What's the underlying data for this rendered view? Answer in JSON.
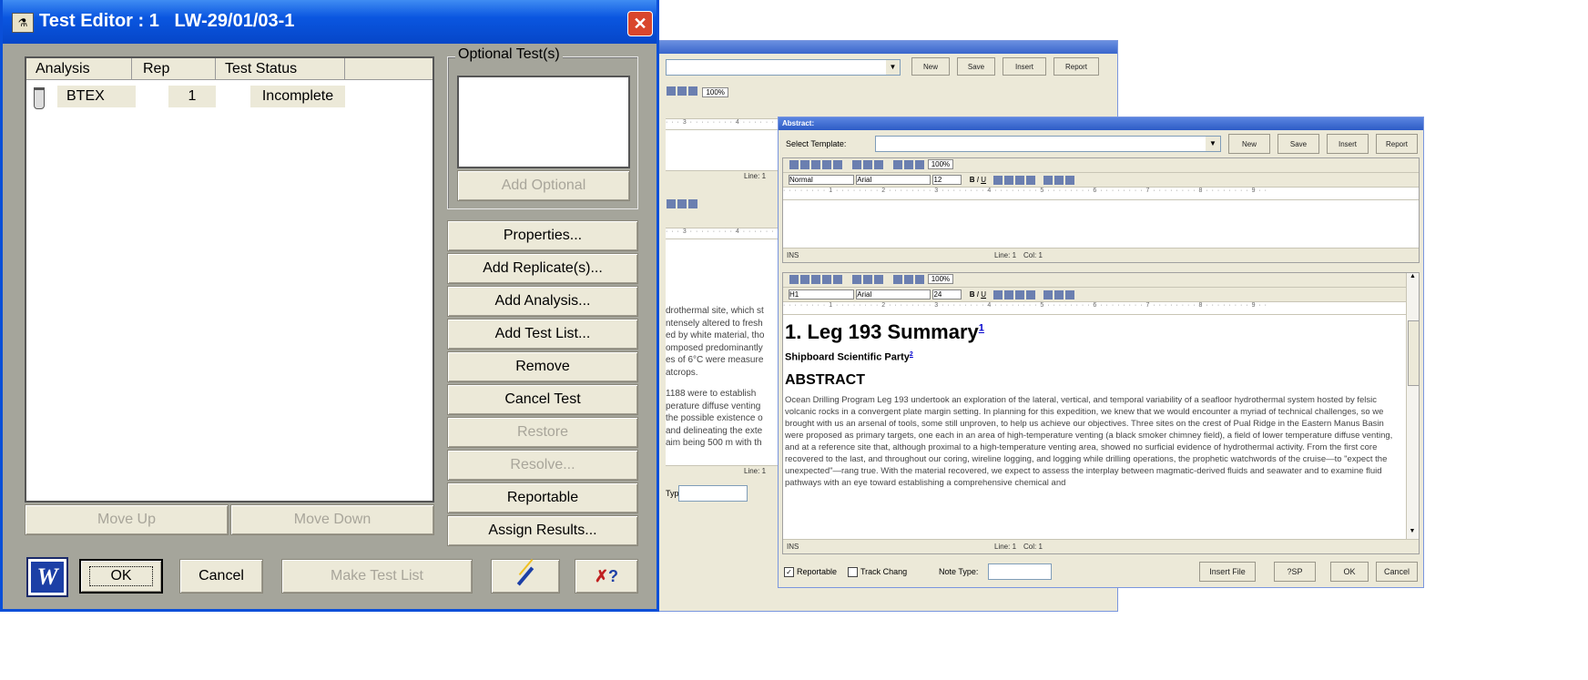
{
  "dialog": {
    "title": "Test Editor : 1   LW-29/01/03-1",
    "table": {
      "headers": [
        "Analysis",
        "Rep",
        "Test Status"
      ],
      "rows": [
        {
          "analysis": "BTEX",
          "rep": "1",
          "status": "Incomplete"
        }
      ]
    },
    "optional_group_label": "Optional Test(s)",
    "add_optional": "Add Optional",
    "side_buttons": [
      "Properties...",
      "Add Replicate(s)...",
      "Add Analysis...",
      "Add Test List...",
      "Remove",
      "Cancel Test",
      "Restore",
      "Resolve...",
      "Reportable",
      "Assign Results..."
    ],
    "move_up": "Move Up",
    "move_down": "Move Down",
    "ok": "OK",
    "cancel": "Cancel",
    "make_test_list": "Make Test List"
  },
  "back_window": {
    "buttons": [
      "New",
      "Save",
      "Insert",
      "Report"
    ],
    "zoom": "100%",
    "line_label": "Line: 1",
    "note_type_label": "Type:",
    "body_lines": [
      "drothermal site, which st",
      "ntensely altered to fresh",
      "ed by white material, tho",
      "omposed predominantly",
      "es of 6°C were measure",
      "atcrops.",
      "",
      "1188 were to establish",
      "perature diffuse venting",
      "the possible existence o",
      "and delineating the exte",
      "aim being 500 m with th"
    ]
  },
  "abstract_window": {
    "title": "Abstract:",
    "select_template_label": "Select Template:",
    "buttons": [
      "New",
      "Save",
      "Insert",
      "Report"
    ],
    "editor1": {
      "style": "Normal",
      "font": "Arial",
      "size": "12",
      "zoom": "100%",
      "status_ins": "INS",
      "status_line": "Line: 1",
      "status_col": "Col: 1"
    },
    "editor2": {
      "style": "H1",
      "font": "Arial",
      "size": "24",
      "zoom": "100%",
      "status_ins": "INS",
      "status_line": "Line: 1",
      "status_col": "Col: 1"
    },
    "doc": {
      "heading": "1. Leg 193 Summary",
      "heading_sup": "1",
      "subheading": "Shipboard Scientific Party",
      "subheading_sup": "2",
      "abstract_heading": "ABSTRACT",
      "paragraph": "Ocean Drilling Program Leg 193 undertook an exploration of the lateral, vertical, and temporal variability of a seafloor hydrothermal system hosted by felsic volcanic rocks in a convergent plate margin setting. In planning for this expedition, we knew that we would encounter a myriad of technical challenges, so we brought with us an arsenal of tools, some still unproven, to help us achieve our objectives. Three sites on the crest of Pual Ridge in the Eastern Manus Basin were proposed as primary targets, one each in an area of high-temperature venting (a black smoker chimney field), a field of lower temperature diffuse venting, and at a reference site that, although proximal to a high-temperature venting area, showed no surficial evidence of hydrothermal activity. From the first core recovered to the last, and throughout our coring, wireline logging, and logging while drilling operations, the prophetic watchwords of the cruise—to \"expect the unexpected\"—rang true. With the material recovered, we expect to assess the interplay between magmatic-derived fluids and seawater and to examine fluid pathways with an eye toward establishing a comprehensive chemical and"
    },
    "footer": {
      "reportable": "Reportable",
      "track_changes": "Track Chang",
      "note_type": "Note Type:",
      "insert_file": "Insert File",
      "sp": "?SP",
      "ok": "OK",
      "cancel": "Cancel"
    }
  },
  "colors": {
    "titlebar": "#0a4fd8",
    "dialog_bg": "#a5a59b",
    "button_face": "#ece9d8",
    "close": "#d9462c"
  }
}
